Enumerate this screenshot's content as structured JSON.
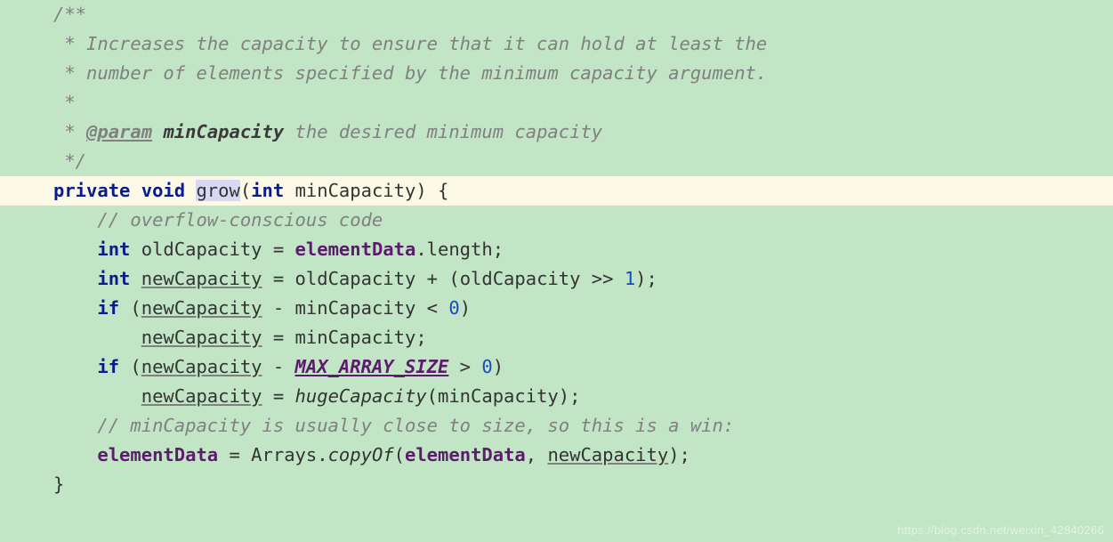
{
  "watermark": "https://blog.csdn.net/weixin_42840266",
  "code": {
    "c1": "/**",
    "c2": " * Increases the capacity to ensure that it can hold at least the",
    "c3": " * number of elements specified by the minimum capacity argument.",
    "c4": " *",
    "c5_pre": " * ",
    "c5_tag": "@param",
    "c5_name": "minCapacity",
    "c5_rest": " the desired minimum capacity",
    "c6": " */",
    "sig_private": "private",
    "sig_void": "void",
    "sig_name": "grow",
    "sig_int": "int",
    "sig_param": "minCapacity",
    "body1": "// overflow-conscious code",
    "l2_int": "int",
    "l2_var": "oldCapacity",
    "l2_field": "elementData",
    "l2_prop": "length",
    "l3_int": "int",
    "l3_var": "newCapacity",
    "l3_rhs1": "oldCapacity",
    "l3_rhs2": "oldCapacity",
    "l3_num": "1",
    "l4_if": "if",
    "l4_nc": "newCapacity",
    "l4_mc": "minCapacity",
    "l4_zero": "0",
    "l5_nc": "newCapacity",
    "l5_mc": "minCapacity",
    "l6_if": "if",
    "l6_nc": "newCapacity",
    "l6_const": "MAX_ARRAY_SIZE",
    "l6_zero": "0",
    "l7_nc": "newCapacity",
    "l7_fn": "hugeCapacity",
    "l7_arg": "minCapacity",
    "body8": "// minCapacity is usually close to size, so this is a win:",
    "l9_field": "elementData",
    "l9_arrays": "Arrays",
    "l9_copy": "copyOf",
    "l9_arg1": "elementData",
    "l9_arg2": "newCapacity"
  }
}
